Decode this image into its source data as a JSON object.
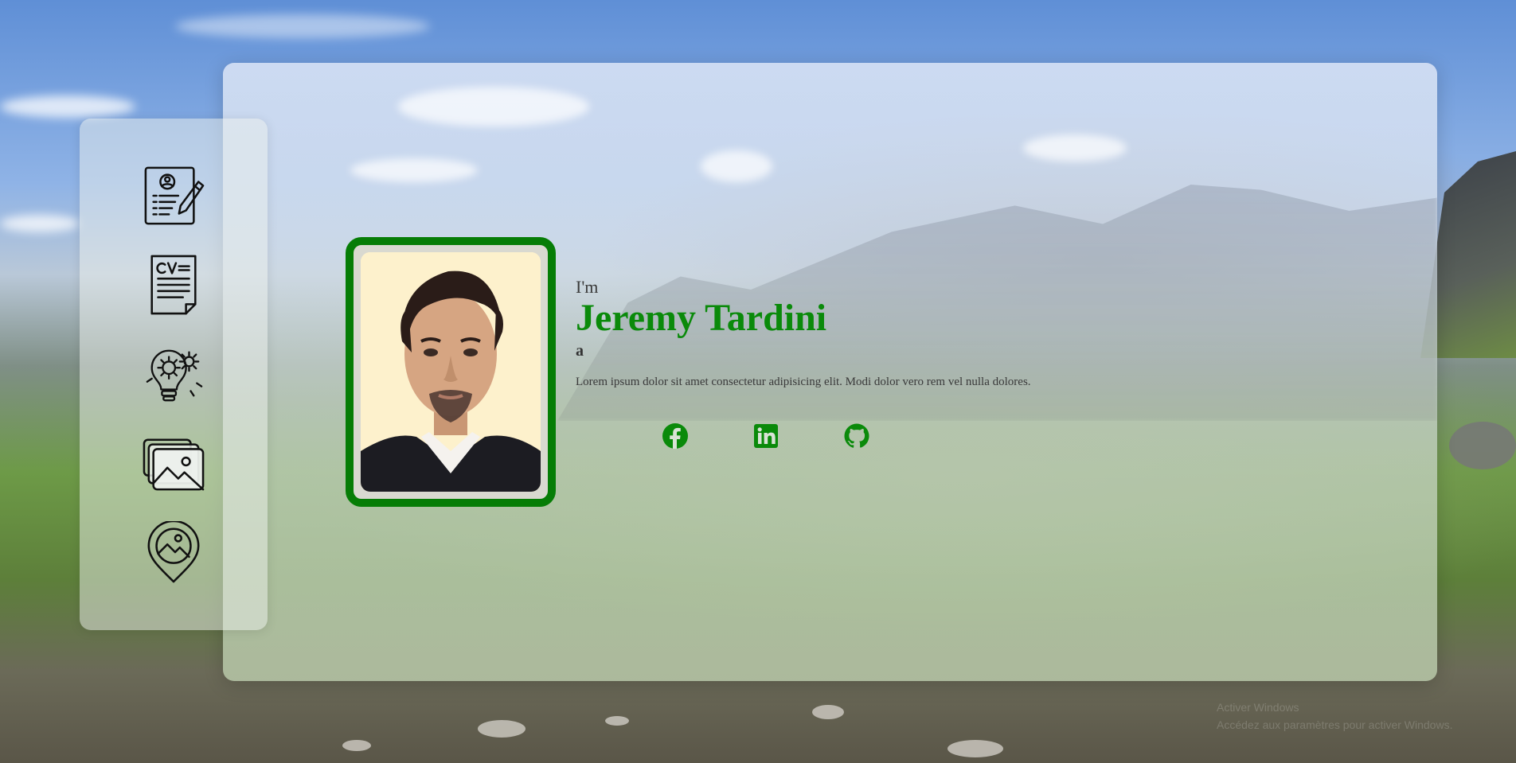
{
  "nav": {
    "items": [
      {
        "name": "resume",
        "icon": "resume-profile-icon"
      },
      {
        "name": "cv",
        "icon": "cv-document-icon"
      },
      {
        "name": "skills",
        "icon": "gear-bulb-icon"
      },
      {
        "name": "gallery",
        "icon": "photo-gallery-icon"
      },
      {
        "name": "location",
        "icon": "map-pin-landscape-icon"
      }
    ]
  },
  "profile": {
    "greeting": "I'm",
    "name": "Jeremy Tardini",
    "role": "a",
    "bio": "Lorem ipsum dolor sit amet consectetur adipisicing elit. Modi dolor vero rem vel nulla dolores."
  },
  "social": {
    "icons": [
      "facebook-icon",
      "linkedin-icon",
      "github-icon"
    ]
  },
  "colors": {
    "accent": "#0a8a0a",
    "frame": "#067d06"
  },
  "watermark": {
    "line1": "Activer Windows",
    "line2": "Accédez aux paramètres pour activer Windows."
  }
}
